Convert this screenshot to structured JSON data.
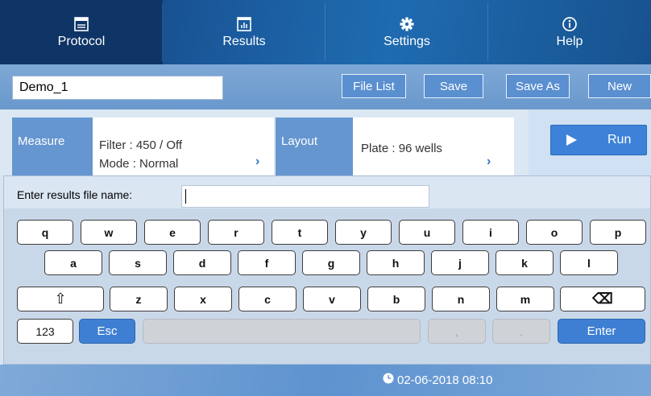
{
  "nav": {
    "items": [
      {
        "label": "Protocol",
        "icon": "protocol-icon",
        "active": true
      },
      {
        "label": "Results",
        "icon": "results-chart-icon",
        "active": false
      },
      {
        "label": "Settings",
        "icon": "gear-icon",
        "active": false
      },
      {
        "label": "Help",
        "icon": "info-icon",
        "active": false
      }
    ]
  },
  "toolbar": {
    "protocol_name": "Demo_1",
    "file_list": "File List",
    "save": "Save",
    "save_as": "Save As",
    "new": "New"
  },
  "measure": {
    "label": "Measure",
    "filter_label": "Filter :",
    "filter_value": "450 / Off",
    "mode_label": "Mode :",
    "mode_value": "Normal"
  },
  "layout_panel": {
    "label": "Layout",
    "plate_label": "Plate :",
    "plate_value": "96 wells"
  },
  "run": {
    "label": "Run"
  },
  "keyboard": {
    "prompt": "Enter results file name:",
    "input_value": "",
    "row1": [
      "q",
      "w",
      "e",
      "r",
      "t",
      "y",
      "u",
      "i",
      "o",
      "p"
    ],
    "row2": [
      "a",
      "s",
      "d",
      "f",
      "g",
      "h",
      "j",
      "k",
      "l"
    ],
    "row3": [
      "z",
      "x",
      "c",
      "v",
      "b",
      "n",
      "m"
    ],
    "shift_symbol": "⇧",
    "backspace_symbol": "⌫",
    "numbers": "123",
    "esc": "Esc",
    "comma": ",",
    "period": ".",
    "enter": "Enter"
  },
  "status": {
    "datetime": "02-06-2018 08:10"
  },
  "colors": {
    "nav_bg": "#1a5a9c",
    "accent": "#3f7fd3",
    "panel_label": "#6596d0"
  }
}
